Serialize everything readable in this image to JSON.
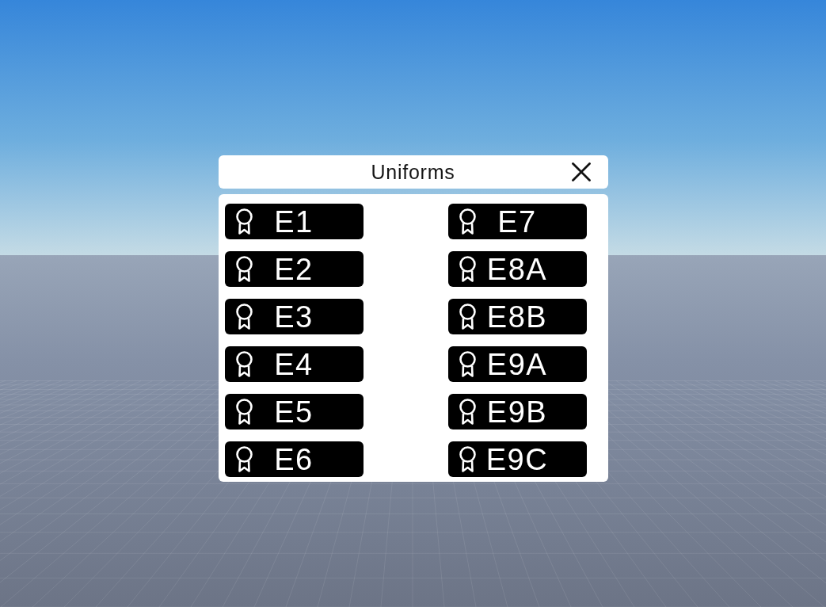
{
  "window": {
    "title": "Uniforms"
  },
  "uniforms": {
    "left_column": [
      {
        "label": "E1"
      },
      {
        "label": "E2"
      },
      {
        "label": "E3"
      },
      {
        "label": "E4"
      },
      {
        "label": "E5"
      },
      {
        "label": "E6"
      }
    ],
    "right_column": [
      {
        "label": "E7"
      },
      {
        "label": "E8A"
      },
      {
        "label": "E8B"
      },
      {
        "label": "E9A"
      },
      {
        "label": "E9B"
      },
      {
        "label": "E9C"
      }
    ]
  }
}
